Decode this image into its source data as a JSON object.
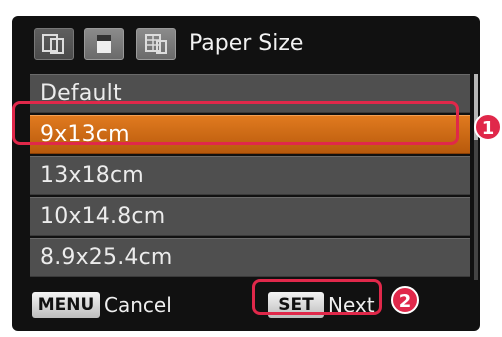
{
  "header": {
    "tabs": [
      {
        "icon": "layout-tab-icon"
      },
      {
        "icon": "page-tab-icon"
      },
      {
        "icon": "grid-tab-icon"
      }
    ],
    "title": "Paper Size"
  },
  "list": {
    "items": [
      {
        "label": "Default"
      },
      {
        "label": "9x13cm"
      },
      {
        "label": "13x18cm"
      },
      {
        "label": "10x14.8cm"
      },
      {
        "label": "8.9x25.4cm"
      }
    ],
    "selected": "9x13cm"
  },
  "footer": {
    "menu_key": "MENU",
    "cancel_label": "Cancel",
    "set_key": "SET",
    "next_label": "Next"
  },
  "callouts": [
    "1",
    "2"
  ],
  "colors": {
    "selection": "#d46a15",
    "callout": "#e0284a"
  }
}
